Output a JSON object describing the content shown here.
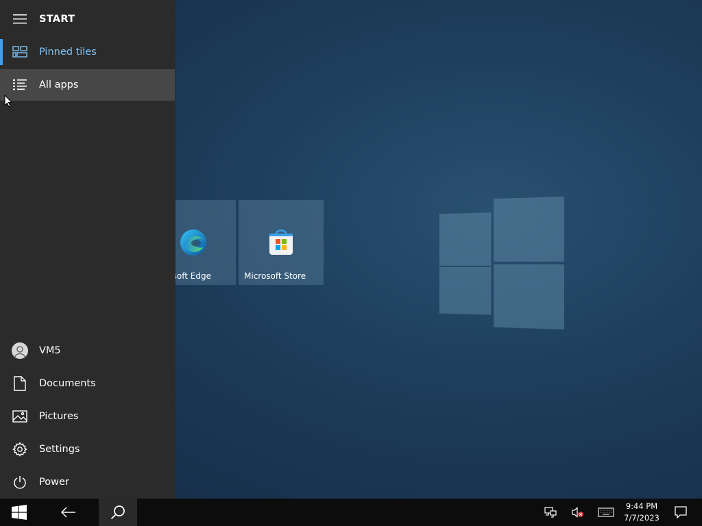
{
  "start_menu": {
    "title": "START",
    "nav": {
      "pinned_tiles": "Pinned tiles",
      "all_apps": "All apps"
    },
    "footer": {
      "user": "VM5",
      "documents": "Documents",
      "pictures": "Pictures",
      "settings": "Settings",
      "power": "Power"
    }
  },
  "tiles": [
    {
      "label": "osoft Edge",
      "icon": "edge-icon"
    },
    {
      "label": "Microsoft Store",
      "icon": "store-icon"
    }
  ],
  "taskbar": {
    "time": "9:44 PM",
    "date": "7/7/2023",
    "icons": [
      "windows-start-icon",
      "back-arrow-icon",
      "search-icon",
      "network-icon",
      "volume-muted-icon",
      "keyboard-icon",
      "notifications-icon"
    ]
  },
  "colors": {
    "accent": "#3d9ff0",
    "selected_label": "#80c4f5",
    "panel_bg": "#2b2b2b",
    "taskbar_bg": "#0c0c0c"
  }
}
